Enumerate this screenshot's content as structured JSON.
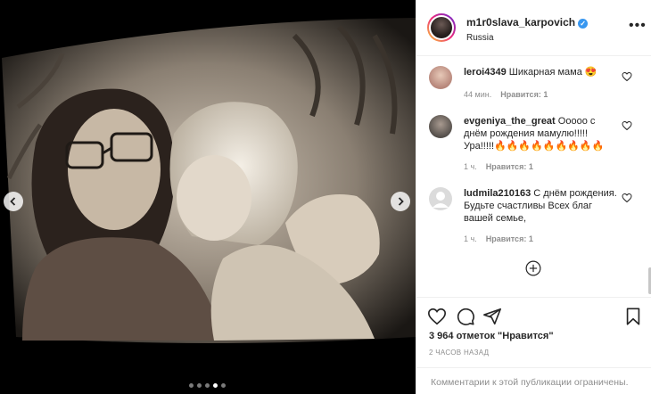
{
  "post": {
    "username": "m1r0slava_karpovich",
    "location": "Russia",
    "more_icon": "more-options-icon",
    "verified_icon": "verified-badge-icon"
  },
  "photo": {
    "prev_icon": "chevron-left-icon",
    "next_icon": "chevron-right-icon",
    "slides_total": 5,
    "slide_active": 4
  },
  "comments": [
    {
      "username": "leroi4349",
      "text": "Шикарная мама 😍",
      "time": "44 мин.",
      "likes": "Нравится: 1"
    },
    {
      "username": "evgeniya_the_great",
      "text": "Ооооо с днём рождения мамулю!!!!! Ура!!!!!🔥🔥🔥🔥🔥🔥🔥🔥🔥",
      "time": "1 ч.",
      "likes": "Нравится: 1"
    },
    {
      "username": "ludmila210163",
      "text": "С днём рождения. Будьте счастливы Всех благ вашей семье,",
      "time": "1 ч.",
      "likes": "Нравится: 1"
    }
  ],
  "actions": {
    "like_count": "3 964 отметок \"Нравится\"",
    "time_ago": "2 ЧАСОВ НАЗАД",
    "comments_restricted": "Комментарии к этой публикации ограничены."
  },
  "colors": {
    "link_blue": "#3897f0",
    "muted": "#8e8e8e",
    "text": "#262626"
  }
}
